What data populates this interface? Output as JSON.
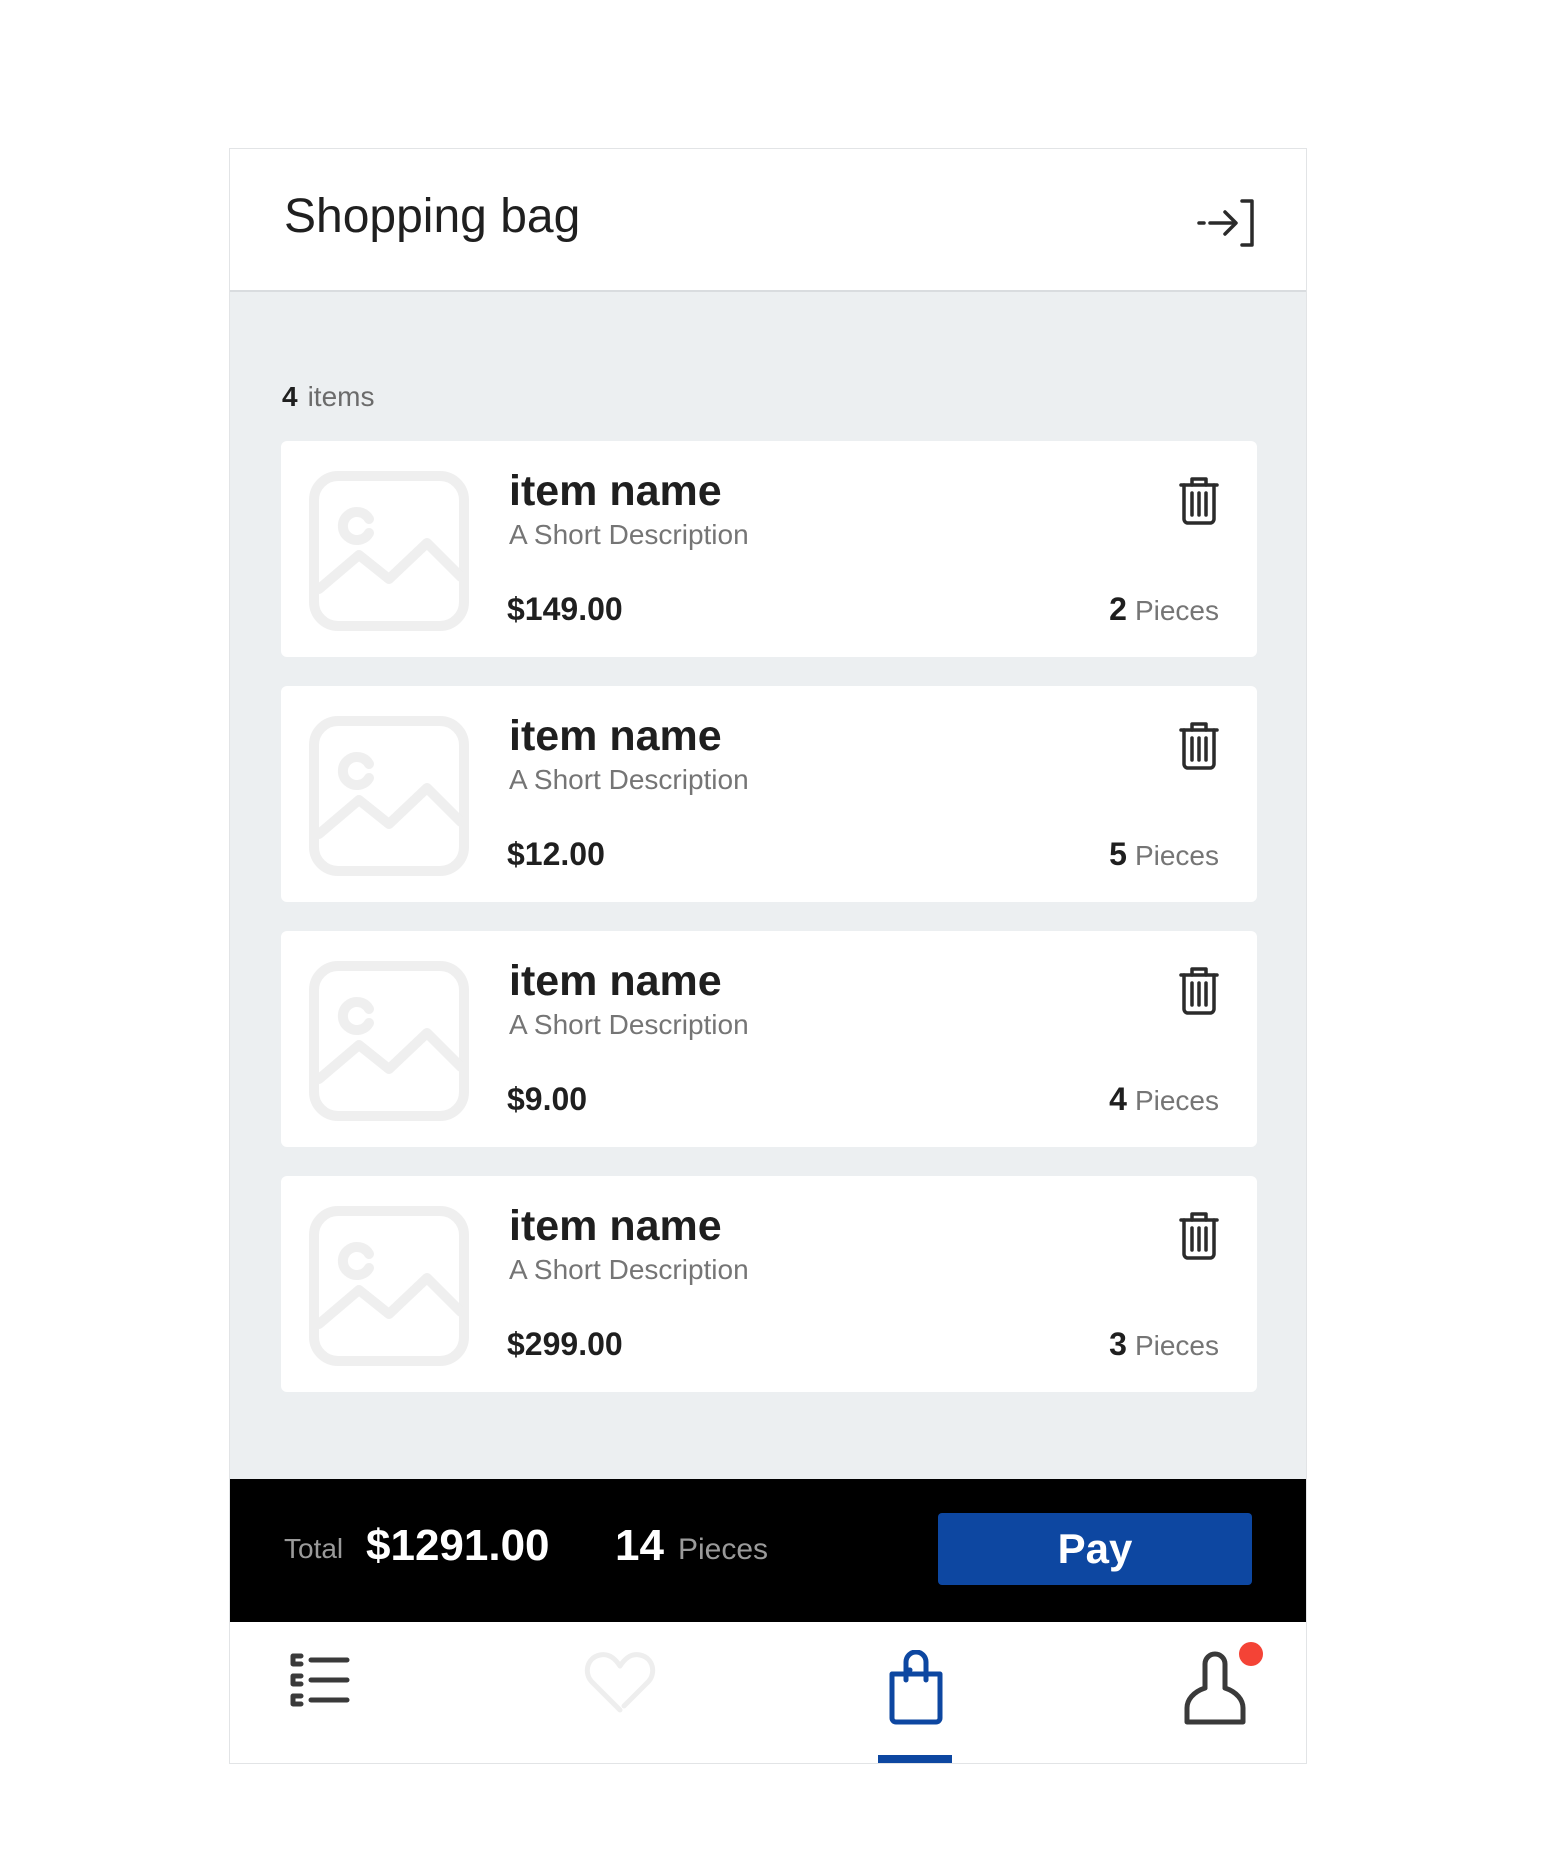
{
  "header": {
    "title": "Shopping bag",
    "exit_icon": "logout-arrow-icon"
  },
  "summary": {
    "count": "4",
    "count_label": "items"
  },
  "items": [
    {
      "name": "item name",
      "description": "A Short Description",
      "price": "$149.00",
      "quantity": "2",
      "quantity_label": "Pieces"
    },
    {
      "name": "item name",
      "description": "A Short Description",
      "price": "$12.00",
      "quantity": "5",
      "quantity_label": "Pieces"
    },
    {
      "name": "item name",
      "description": "A Short Description",
      "price": "$9.00",
      "quantity": "4",
      "quantity_label": "Pieces"
    },
    {
      "name": "item name",
      "description": "A Short Description",
      "price": "$299.00",
      "quantity": "3",
      "quantity_label": "Pieces"
    }
  ],
  "totals": {
    "label": "Total",
    "amount": "$1291.00",
    "pieces": "14",
    "pieces_label": "Pieces",
    "pay_label": "Pay"
  },
  "nav": {
    "items": [
      {
        "icon": "list-icon",
        "active": false
      },
      {
        "icon": "heart-icon",
        "active": false
      },
      {
        "icon": "shopping-bag-icon",
        "active": true
      },
      {
        "icon": "user-icon",
        "active": false,
        "notification": true
      }
    ]
  },
  "colors": {
    "accent": "#0d47a1",
    "background": "#eceff1",
    "notification": "#f44336",
    "total_bar": "#000000"
  }
}
